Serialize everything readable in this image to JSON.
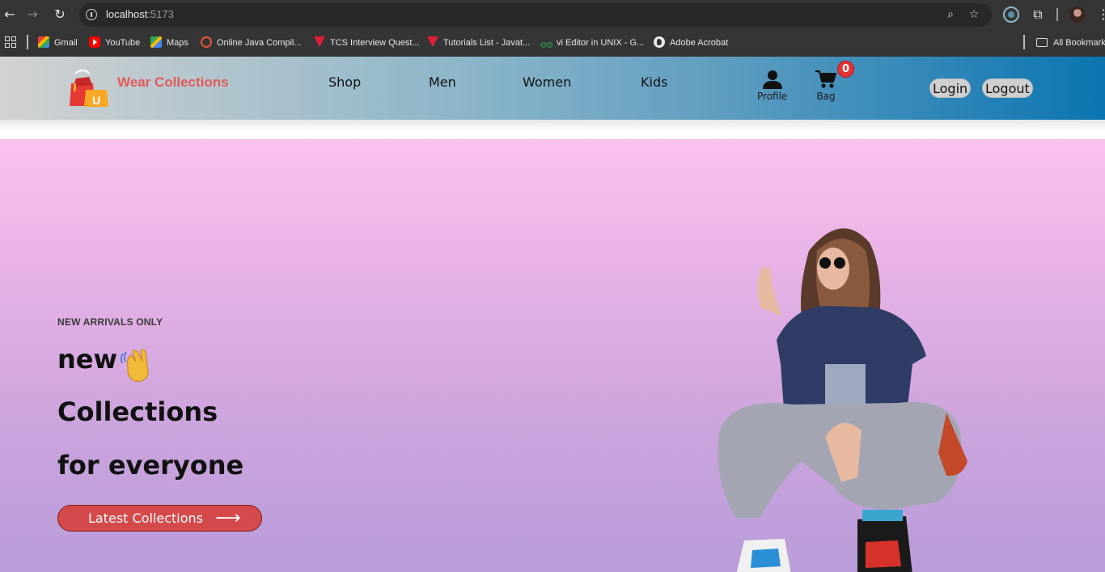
{
  "browser": {
    "url_host": "localhost",
    "url_port": ":5173",
    "bookmarks": [
      {
        "label": "Gmail",
        "icon": "gmail-icon"
      },
      {
        "label": "YouTube",
        "icon": "youtube-icon"
      },
      {
        "label": "Maps",
        "icon": "maps-icon"
      },
      {
        "label": "Online Java Compil...",
        "icon": "java-compiler-icon"
      },
      {
        "label": "TCS Interview Quest...",
        "icon": "javatpoint-icon"
      },
      {
        "label": "Tutorials List - Javat...",
        "icon": "javatpoint-icon"
      },
      {
        "label": "vi Editor in UNIX - G...",
        "icon": "geeksforgeeks-icon"
      },
      {
        "label": "Adobe Acrobat",
        "icon": "globe-icon"
      }
    ],
    "all_bookmarks": "All Bookmarks"
  },
  "header": {
    "brand": "Wear Collections",
    "nav": [
      "Shop",
      "Men",
      "Women",
      "Kids"
    ],
    "profile_label": "Profile",
    "bag_label": "Bag",
    "bag_count": "0",
    "login": "Login",
    "logout": "Logout",
    "brand_color": "#e05a58"
  },
  "hero": {
    "kicker": "NEW ARRIVALS ONLY",
    "line1": "new",
    "line2": "Collections",
    "line3": "for everyone",
    "cta": "Latest Collections",
    "cta_color": "#d44a4a"
  }
}
